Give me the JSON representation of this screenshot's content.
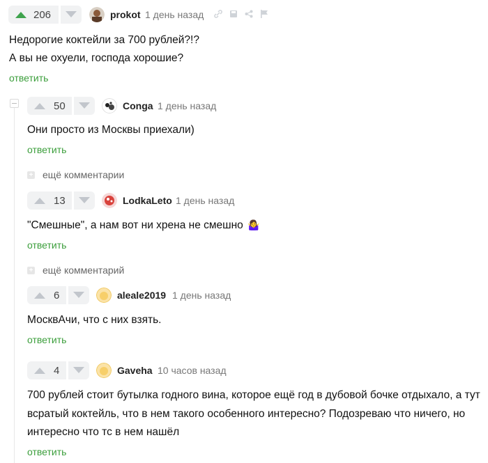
{
  "top_comment": {
    "votes": "206",
    "username": "prokot",
    "time": "1 день назад",
    "text_line1": "Недорогие коктейли за 700 рублей?!?",
    "text_line2": "А вы не охуели, господа хорошие?",
    "reply_label": "ответить",
    "icons": [
      "link-icon",
      "save-icon",
      "share-icon",
      "flag-icon"
    ]
  },
  "replies": [
    {
      "votes": "50",
      "username": "Conga",
      "time": "1 день назад",
      "text": "Они просто из Москвы приехали)",
      "reply_label": "ответить"
    },
    {
      "votes": "13",
      "username": "LodkaLeto",
      "time": "1 день назад",
      "text": "\"Смешные\", а нам вот ни хрена не смешно",
      "emoji": "🤷‍♀️",
      "reply_label": "ответить"
    },
    {
      "votes": "6",
      "username": "aleale2019",
      "time": "1 день назад",
      "text": "МосквАчи, что с них взять.",
      "reply_label": "ответить"
    },
    {
      "votes": "4",
      "username": "Gaveha",
      "time": "10 часов назад",
      "text_line1": "700 рублей стоит бутылка годного вина, которое ещё год в дубовой бочке отдыхало, а тут",
      "text_line2": "всратый коктейль, что в нем такого особенного интересно? Подозреваю что ничего, но",
      "text_line3": "интересно что тс в нем нашёл",
      "reply_label": "ответить"
    }
  ],
  "more_comments": [
    "ещё комментарии",
    "ещё комментарий"
  ],
  "colors": {
    "upvote_active": "#3fa34d",
    "arrow_gray": "#c2c6cc",
    "reply_green": "#3b9e3b",
    "button_bg": "#f1f2f3"
  }
}
